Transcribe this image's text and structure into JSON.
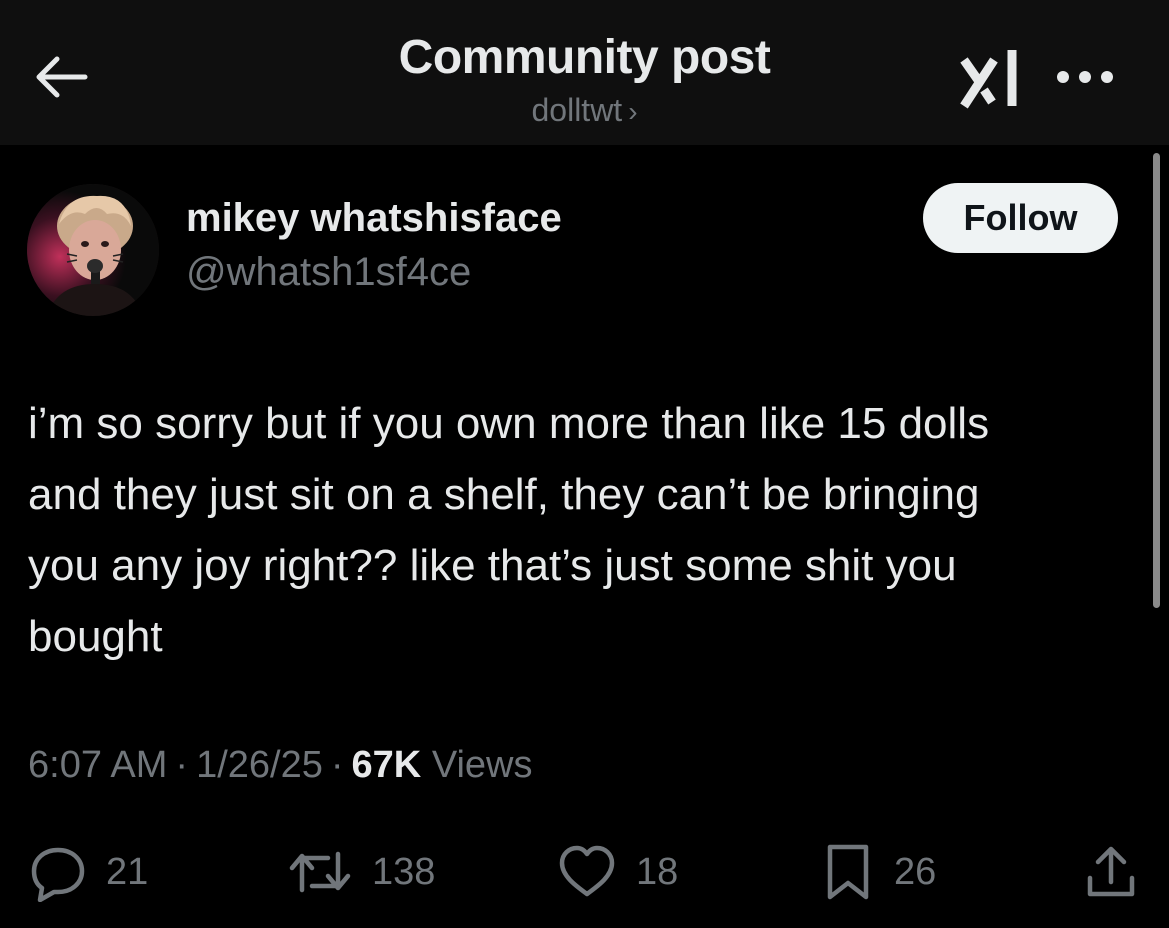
{
  "header": {
    "title": "Community post",
    "community": "dolltwt",
    "chevron": "›",
    "back_icon": "arrow-left-icon",
    "grok_icon": "grok-icon",
    "more_icon": "more-horizontal-icon"
  },
  "author": {
    "name": "mikey whatshisface",
    "handle": "@whatsh1sf4ce",
    "follow_label": "Follow"
  },
  "post": {
    "lines": [
      "i’m so sorry but if you own more than like 15 dolls",
      "and they just sit on a shelf, they can’t be bringing",
      "you any joy right?? like that’s just some shit you",
      "bought"
    ]
  },
  "meta": {
    "time": "6:07 AM",
    "date": "1/26/25",
    "separator": "·",
    "views_count": "67K",
    "views_label": "Views"
  },
  "actions": {
    "replies": "21",
    "reposts": "138",
    "likes": "18",
    "bookmarks": "26"
  },
  "colors": {
    "background": "#000000",
    "header_bg": "#0f0f0f",
    "text_primary": "#e7e9ea",
    "text_secondary": "#71767b",
    "follow_bg": "#eff3f4"
  }
}
